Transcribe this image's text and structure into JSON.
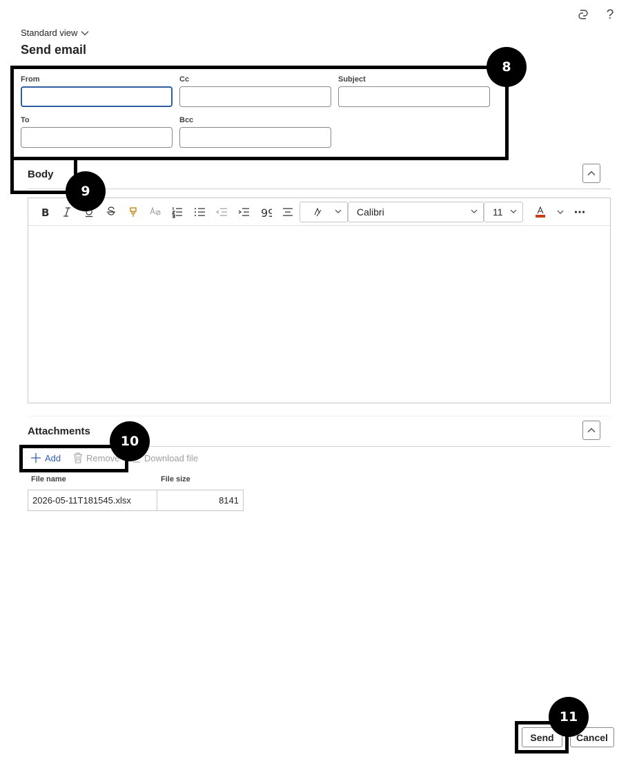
{
  "header": {
    "copilot_icon": "copilot-icon",
    "help_label": "?",
    "view_label": "Standard view",
    "title": "Send email"
  },
  "fields": {
    "from": {
      "label": "From",
      "value": ""
    },
    "cc": {
      "label": "Cc",
      "value": ""
    },
    "subject": {
      "label": "Subject",
      "value": ""
    },
    "to": {
      "label": "To",
      "value": ""
    },
    "bcc": {
      "label": "Bcc",
      "value": ""
    }
  },
  "body": {
    "title": "Body",
    "toolbar": {
      "font": "Calibri",
      "size": "11",
      "icons": [
        "bold-icon",
        "italic-icon",
        "underline-icon",
        "strikethrough-icon",
        "format-painter-icon",
        "clear-format-icon",
        "numbered-list-icon",
        "bullet-list-icon",
        "decrease-indent-icon",
        "increase-indent-icon",
        "quote-icon",
        "align-icon",
        "style-icon",
        "font-color-icon",
        "more-icon"
      ],
      "font_color": "#c43e1c"
    },
    "content": ""
  },
  "attachments": {
    "title": "Attachments",
    "add_label": "Add",
    "remove_label": "Remove",
    "download_label": "Download file",
    "columns": [
      "File name",
      "File size"
    ],
    "rows": [
      {
        "name": "2026-05-11T181545.xlsx",
        "size": "8141"
      }
    ]
  },
  "footer": {
    "send_label": "Send",
    "cancel_label": "Cancel"
  },
  "callouts": [
    "8",
    "9",
    "10",
    "11"
  ],
  "colors": {
    "accent": "#2f5db8",
    "focus_border": "#2f5d9e",
    "callout": "#000000"
  }
}
